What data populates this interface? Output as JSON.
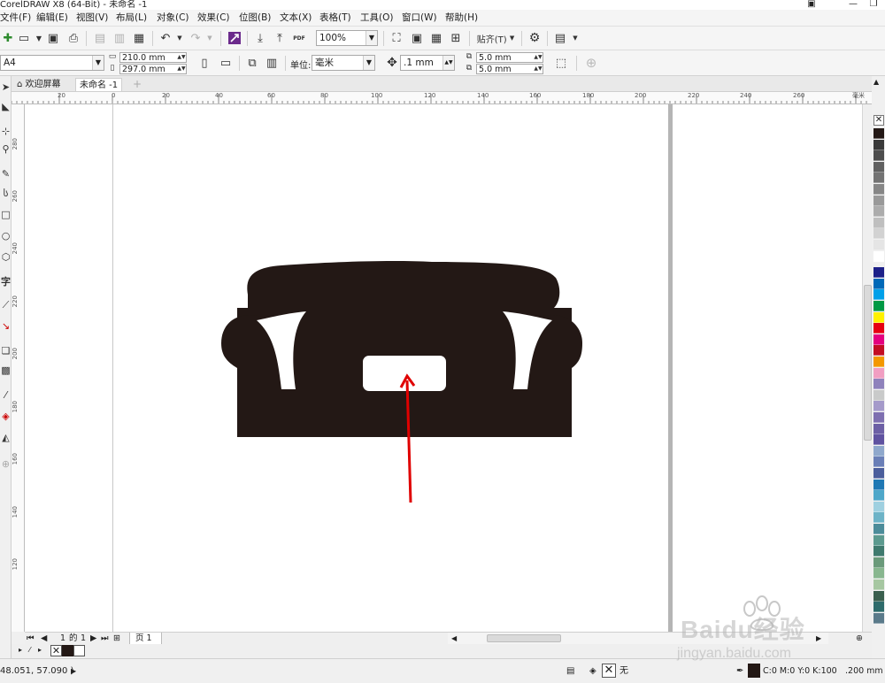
{
  "app": {
    "title": "CorelDRAW X8 (64-Bit) - 未命名 -1"
  },
  "menu": [
    "文件(F)",
    "编辑(E)",
    "视图(V)",
    "布局(L)",
    "对象(C)",
    "效果(C)",
    "位图(B)",
    "文本(X)",
    "表格(T)",
    "工具(O)",
    "窗口(W)",
    "帮助(H)"
  ],
  "toolbar": {
    "zoom_value": "100%",
    "snap_label": "贴齐(T)",
    "pdf_label": "PDF"
  },
  "properties": {
    "page_size": "A4",
    "width": "210.0 mm",
    "height": "297.0 mm",
    "units_label": "单位:",
    "units_value": "毫米",
    "nudge": ".1 mm",
    "dup_x": "5.0 mm",
    "dup_y": "5.0 mm"
  },
  "tabs": {
    "welcome": "欢迎屏幕",
    "doc": "未命名 -1"
  },
  "ruler": {
    "h_ticks": [
      "20",
      "0",
      "20",
      "40",
      "60",
      "80",
      "100",
      "120",
      "140",
      "160",
      "180",
      "200",
      "220",
      "240",
      "260"
    ],
    "h_unit": "毫米",
    "v_ticks": [
      "280",
      "260",
      "240",
      "220",
      "200",
      "180",
      "160",
      "140",
      "120"
    ]
  },
  "page_nav": {
    "current": "1",
    "of_label": "的",
    "total": "1",
    "page_tab": "页 1"
  },
  "status": {
    "coords": "48.051, 57.090 )",
    "fill_none": "无",
    "color_info": "C:0 M:0 Y:0 K:100",
    "outline_width": ".200 mm"
  },
  "colors": {
    "sofa": "#231815",
    "arrow": "#e00000",
    "accent_purple": "#6b2a8c"
  },
  "palette": [
    "#231815",
    "#3a3a3a",
    "#4d4d4d",
    "#606060",
    "#737373",
    "#868686",
    "#999999",
    "#acacac",
    "#bfbfbf",
    "#d2d2d2",
    "#e5e5e5",
    "#ffffff",
    "#1d2088",
    "#0068b7",
    "#00a0e9",
    "#009944",
    "#fff100",
    "#e60012",
    "#e4007f",
    "#c30d23",
    "#f39800",
    "#f19ec2",
    "#8f82bc",
    "#c9caca",
    "#a59aca",
    "#7e6fb0",
    "#6c5fa5",
    "#5f52a0",
    "#8fa8cc",
    "#6a7fb7",
    "#4b5e9c",
    "#1f78b4",
    "#4ea7c9",
    "#9fd0e0",
    "#6db3c7",
    "#4c8c9a",
    "#5c9a8f",
    "#3f7a6e",
    "#6a9a7a",
    "#88b78f",
    "#a6c7a1",
    "#3a5f4e",
    "#2e6b6b",
    "#5a7a8a"
  ],
  "watermark": {
    "brand": "Baidu经验",
    "url": "jingyan.baidu.com"
  }
}
